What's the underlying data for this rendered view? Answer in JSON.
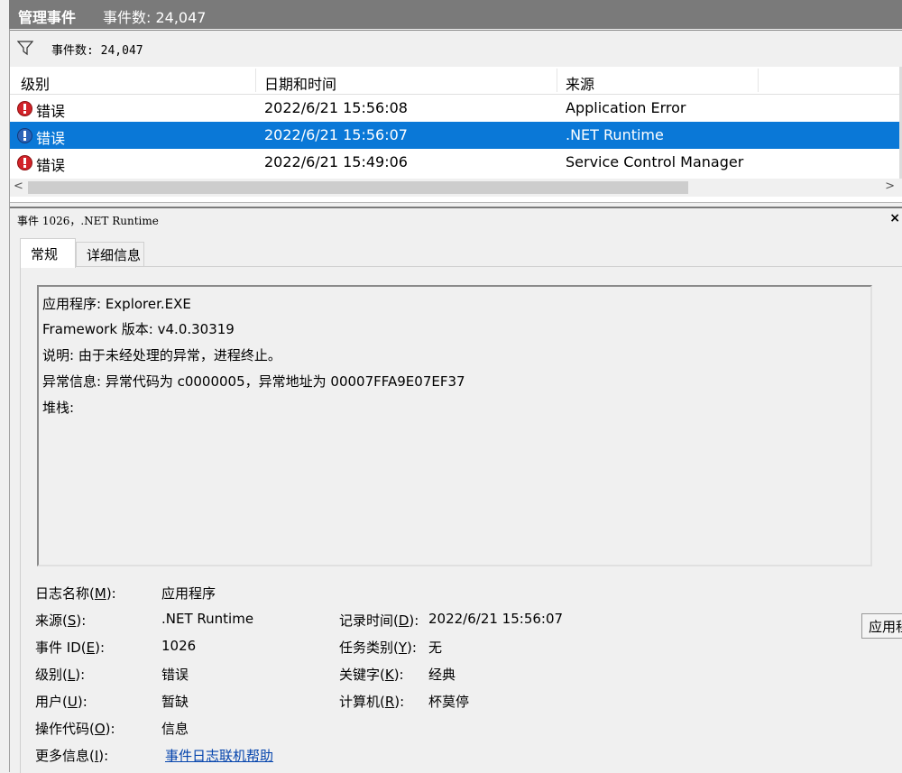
{
  "window": {
    "title": "管理事件",
    "event_count_label": "事件数: 24,047"
  },
  "filter": {
    "label": "事件数: 24,047"
  },
  "grid": {
    "columns": [
      "级别",
      "日期和时间",
      "来源"
    ],
    "rows": [
      {
        "level": "错误",
        "datetime": "2022/6/21 15:56:08",
        "source": "Application Error",
        "selected": false
      },
      {
        "level": "错误",
        "datetime": "2022/6/21 15:56:07",
        "source": ".NET Runtime",
        "selected": true
      },
      {
        "level": "错误",
        "datetime": "2022/6/21 15:49:06",
        "source": "Service Control Manager",
        "selected": false
      }
    ]
  },
  "detail": {
    "header": "事件 1026，.NET Runtime",
    "close_icon": "×",
    "tabs": {
      "general": "常规",
      "details": "详细信息"
    },
    "message": {
      "line1": "应用程序: Explorer.EXE",
      "line2": "Framework 版本: v4.0.30319",
      "line3": "说明: 由于未经处理的异常，进程终止。",
      "line4": "异常信息: 异常代码为 c0000005，异常地址为 00007FFA9E07EF37",
      "line5": "堆栈:"
    },
    "properties": {
      "log_name": {
        "label": "日志名称(",
        "key": "M",
        "suffix": "):",
        "value": "应用程序"
      },
      "source": {
        "label": "来源(",
        "key": "S",
        "suffix": "):",
        "value": ".NET Runtime"
      },
      "event_id": {
        "label": "事件 ID(",
        "key": "E",
        "suffix": "):",
        "value": "1026"
      },
      "level": {
        "label": "级别(",
        "key": "L",
        "suffix": "):",
        "value": "错误"
      },
      "user": {
        "label": "用户(",
        "key": "U",
        "suffix": "):",
        "value": "暂缺"
      },
      "opcode": {
        "label": "操作代码(",
        "key": "O",
        "suffix": "):",
        "value": "信息"
      },
      "more_info": {
        "label": "更多信息(",
        "key": "I",
        "suffix": "):",
        "value": "事件日志联机帮助"
      },
      "logged": {
        "label": "记录时间(",
        "key": "D",
        "suffix": "):",
        "value": "2022/6/21 15:56:07"
      },
      "task_category": {
        "label": "任务类别(",
        "key": "Y",
        "suffix": "):",
        "value": "无"
      },
      "keywords": {
        "label": "关键字(",
        "key": "K",
        "suffix": "):",
        "value": "经典"
      },
      "computer": {
        "label": "计算机(",
        "key": "R",
        "suffix": "):",
        "value": "杯莫停"
      }
    },
    "side_text": "应用程序"
  },
  "colors": {
    "selection": "#0a78d7",
    "error_icon": "#d2232a",
    "titlebar": "#7a7a7a",
    "link": "#0645ad"
  }
}
